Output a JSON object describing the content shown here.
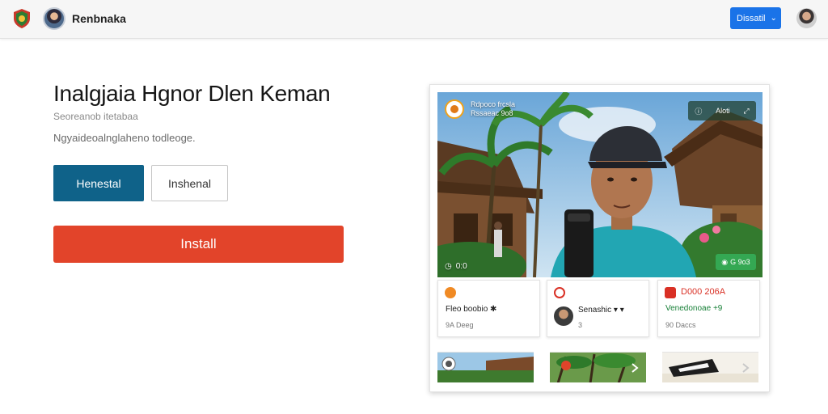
{
  "header": {
    "brand": "Renbnaka",
    "dropdown_label": "Dissatil",
    "dropdown_icon": "chevron-down-icon",
    "logo_icon": "shield-logo-icon"
  },
  "hero": {
    "title": "Inalgjaia Hgnor Dlen Keman",
    "subtitle": "Seoreanob itetabaa",
    "description": "Ngyaideoalnglaheno todleoge.",
    "primary_button": "Henestal",
    "secondary_button": "Inshenal",
    "install_button": "Install"
  },
  "video": {
    "channel_line1": "Rdpoco frcsla",
    "channel_line2": "Rssaeac 9o8",
    "top_right_label": "Aloti",
    "timestamp": "0:0",
    "badge_label": "G 9o3",
    "top_right_icons": [
      "info-icon",
      "expand-icon"
    ]
  },
  "mini_cards": [
    {
      "head": "",
      "title": "Fleo boobio ✱",
      "sub": "9A Deeg",
      "has_avatar": false
    },
    {
      "head": "",
      "title": "Senashic ▾ ▾",
      "sub": "3",
      "has_avatar": true
    },
    {
      "head": "D000 206A",
      "title": "Venedonoae +9",
      "sub": "90 Daccs",
      "has_avatar": false
    }
  ],
  "colors": {
    "primary": "#0f6289",
    "install": "#e2442a",
    "accent_blue": "#1a73e8",
    "badge_green": "#34a853",
    "mini_red": "#d93025",
    "mini_green": "#188038"
  }
}
